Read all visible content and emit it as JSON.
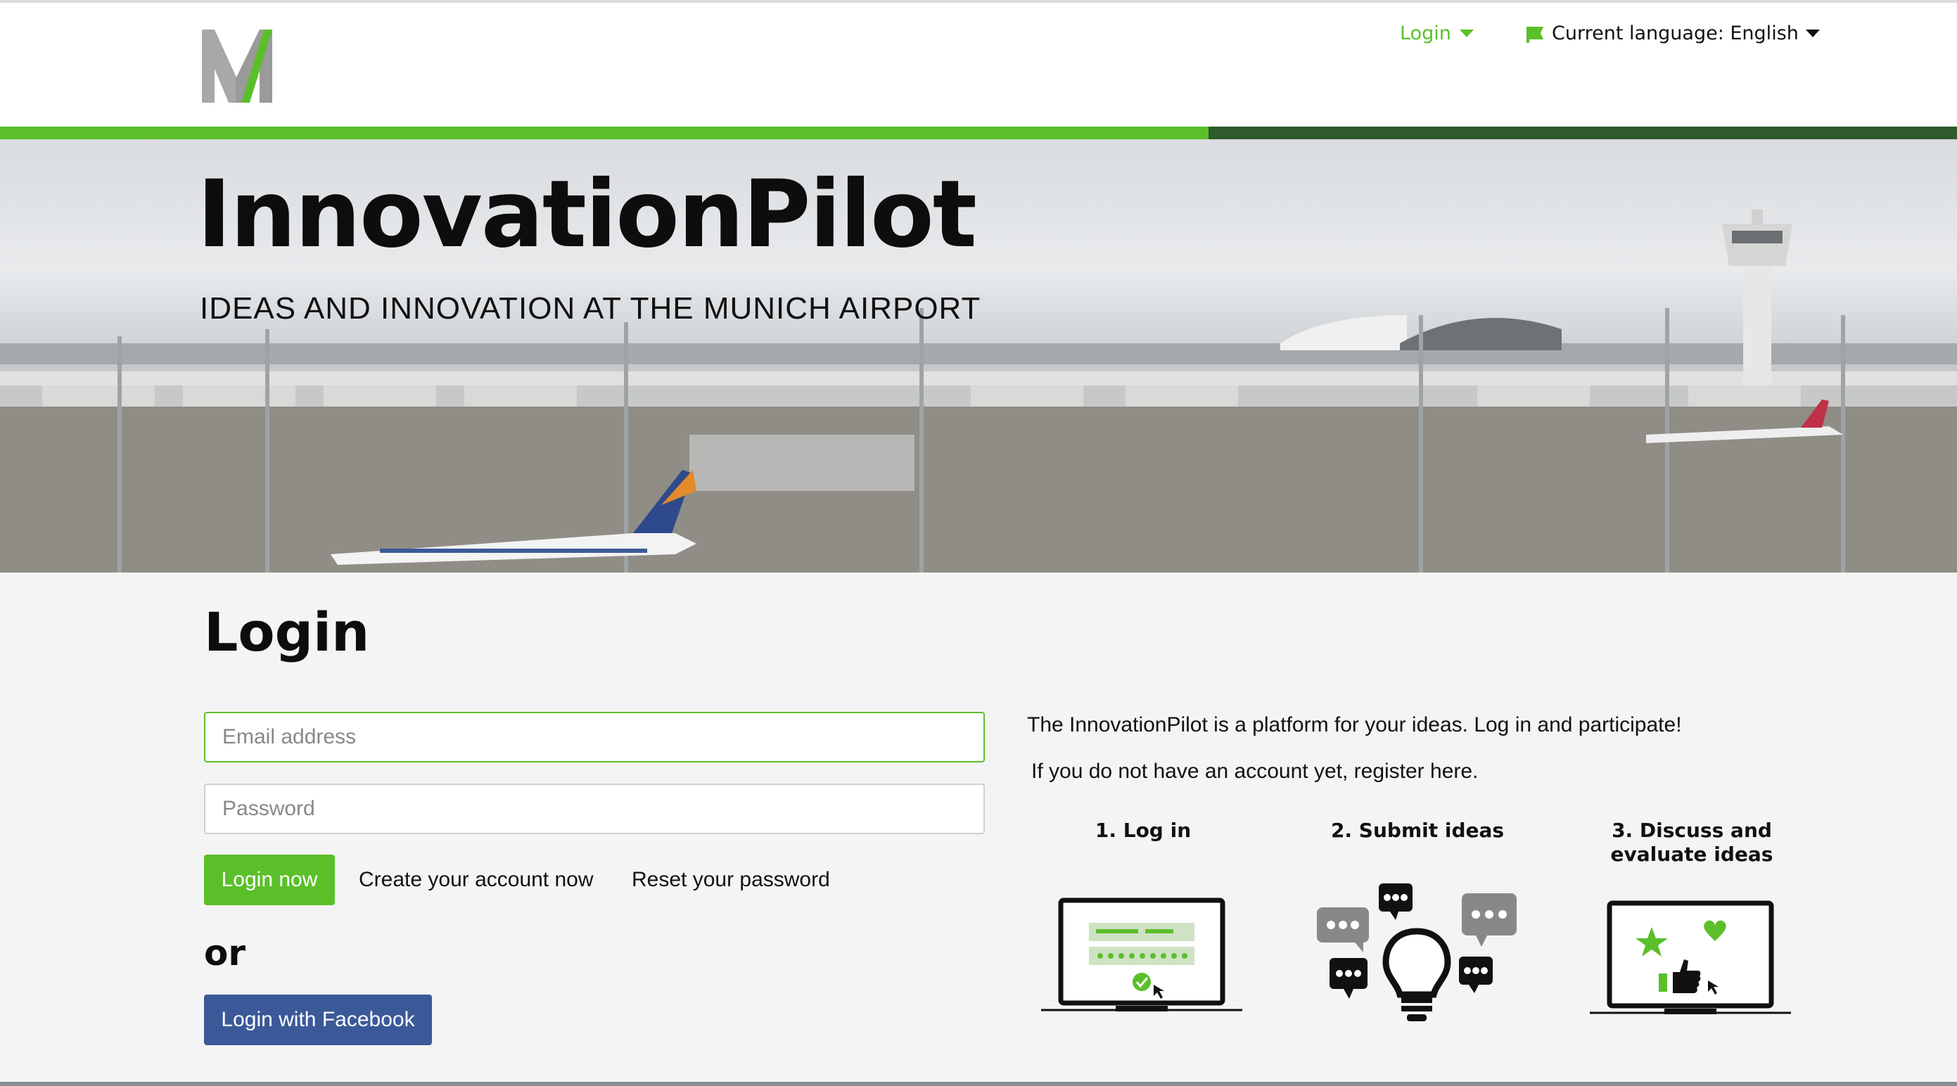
{
  "header": {
    "login_label": "Login",
    "language_label": "Current language: English",
    "icons": {
      "logo": "m-logo",
      "login_caret": "chevron-down-icon",
      "language_flag": "flag-icon",
      "language_caret": "chevron-down-icon"
    }
  },
  "hero": {
    "title": "InnovationPilot",
    "subtitle": "IDEAS AND INNOVATION AT THE MUNICH AIRPORT"
  },
  "login": {
    "title": "Login",
    "email_placeholder": "Email address",
    "password_placeholder": "Password",
    "login_button": "Login now",
    "create_account_link": "Create your account now",
    "reset_password_link": "Reset your password",
    "or_text": "or",
    "facebook_button": "Login with Facebook"
  },
  "info": {
    "intro": "The InnovationPilot is a platform for your ideas. Log in and participate!",
    "register": "If you do not have an account yet, register here.",
    "steps": [
      {
        "label": "1. Log in",
        "icon": "laptop-login-icon"
      },
      {
        "label": "2. Submit ideas",
        "icon": "lightbulb-ideas-icon"
      },
      {
        "label": "3. Discuss and evaluate ideas",
        "icon": "laptop-evaluate-icon"
      }
    ]
  },
  "colors": {
    "accent_green": "#5bbf2a",
    "dark_green": "#2f5a2c",
    "facebook_blue": "#3b5998"
  }
}
